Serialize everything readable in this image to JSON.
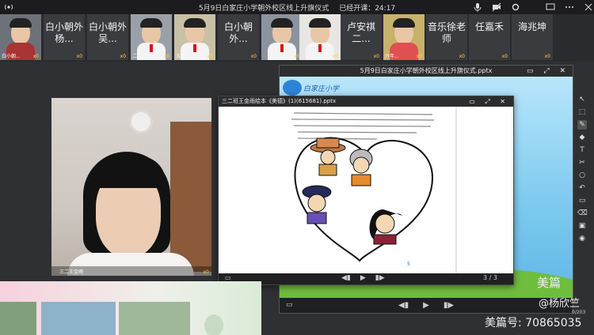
{
  "topbar": {
    "meeting_title": "5月9日白家庄小学朝外校区线上升旗仪式",
    "elapsed": "已经开课：24:17"
  },
  "participants": [
    {
      "name": "",
      "small": "白小朝...",
      "badge": "x0",
      "kind": "video"
    },
    {
      "name": "白小朝外杨...",
      "badge": "x0",
      "kind": "name"
    },
    {
      "name": "白小朝外吴...",
      "badge": "x0",
      "kind": "name"
    },
    {
      "name": "",
      "small": "二...",
      "badge": "x0",
      "kind": "video"
    },
    {
      "name": "",
      "small": "五年...",
      "badge": "x0",
      "kind": "video"
    },
    {
      "name": "白小朝外...",
      "badge": "x0",
      "kind": "name"
    },
    {
      "name": "",
      "small": "",
      "badge": "x0",
      "kind": "video"
    },
    {
      "name": "",
      "small": "",
      "badge": "x0",
      "kind": "video"
    },
    {
      "name": "卢安祺二...",
      "badge": "x0",
      "kind": "name"
    },
    {
      "name": "",
      "small": "六年...",
      "badge": "x0",
      "kind": "video"
    },
    {
      "name": "音乐徐老师",
      "badge": "x0",
      "kind": "name"
    },
    {
      "name": "任嘉禾",
      "badge": "x0",
      "kind": "name"
    },
    {
      "name": "海兆坤",
      "badge": "x0",
      "kind": "name"
    }
  ],
  "main_video": {
    "label": "三二王金雨",
    "badge": "x0"
  },
  "back_window": {
    "title": "5月9日白家庄小学朝外校区线上升旗仪式.pptx",
    "school_name": "白家庄小学"
  },
  "front_window": {
    "title": "三二班王金雨绘本《美德》(1)(615681).pptx",
    "page_indicator": "3 / 3",
    "slide_page_number": "5"
  },
  "watermarks": {
    "brand": "美篇",
    "author": "@杨欣竺",
    "account": "美篇号: 70865035",
    "counter": "0/203"
  },
  "colors": {
    "accent_yellow": "#ffd23c",
    "slide_sky": "#8fd3f5"
  }
}
